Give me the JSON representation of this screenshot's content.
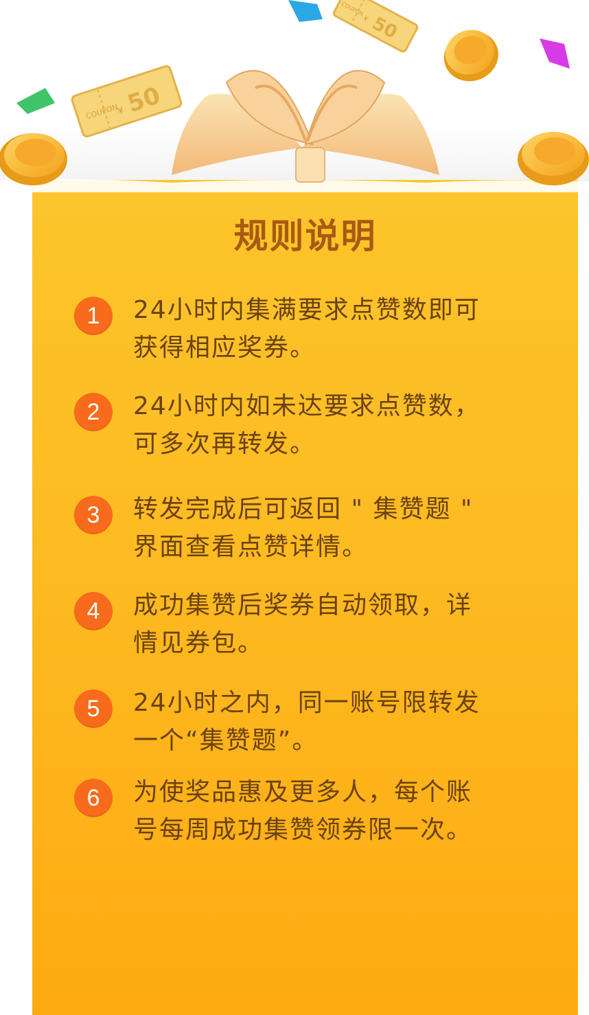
{
  "title": "规则说明",
  "rules": [
    {
      "number": "1",
      "text": "24小时内集满要求点赞数即可\n获得相应奖券。"
    },
    {
      "number": "2",
      "text": "24小时内如未达要求点赞数，\n可多次再转发。"
    },
    {
      "number": "3",
      "text": "转发完成后可返回 \" 集赞题 \"\n界面查看点赞详情。"
    },
    {
      "number": "4",
      "text": "成功集赞后奖券自动领取，详\n情见券包。"
    },
    {
      "number": "5",
      "text": "24小时之内，同一账号限转发\n一个“集赞题”。"
    },
    {
      "number": "6",
      "text": "为使奖品惠及更多人，每个账\n号每周成功集赞领券限一次。"
    }
  ],
  "decorations": {
    "coupon_left": {
      "value": "50",
      "currency": "¥",
      "label": "COUPON"
    },
    "coupon_right": {
      "value": "50",
      "currency": "¥",
      "label": "COUPON"
    }
  },
  "colors": {
    "card_top": "#fcc62b",
    "card_bottom": "#feab12",
    "badge": "#f86a1c",
    "title": "#a85a12",
    "text": "#6a4110"
  }
}
